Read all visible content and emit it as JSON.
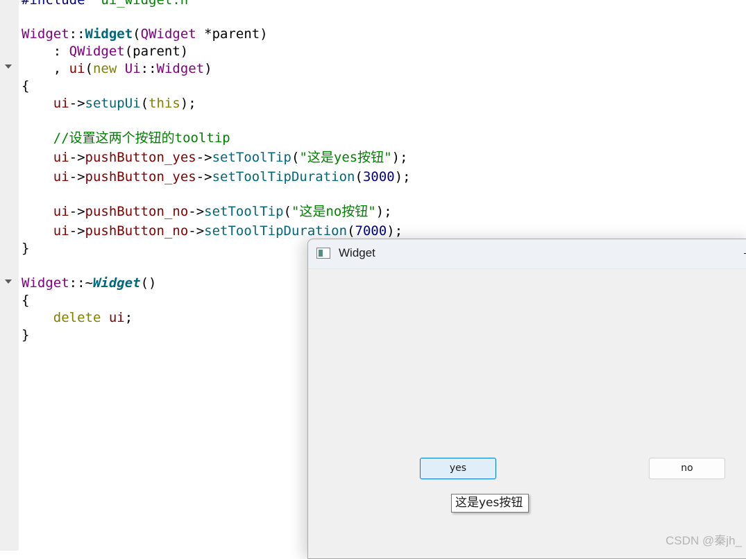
{
  "editor": {
    "lines": {
      "include": {
        "a": "#include \"",
        "b": "ui_widget.h",
        "c": "\""
      },
      "ctor": {
        "cls": "Widget",
        "sep": "::",
        "fn": "Widget",
        "open": "(",
        "type": "QWidget",
        "rest": " *parent)"
      },
      "init1": {
        "pre": "    : ",
        "base": "QWidget",
        "arg": "(parent)"
      },
      "init2": {
        "pre": "    , ",
        "member": "ui",
        "open": "(",
        "kw": "new",
        "sp": " ",
        "ns": "Ui",
        "sep": "::",
        "cls": "Widget",
        "close": ")"
      },
      "brace_open_1": "{",
      "setup": {
        "pre": "    ",
        "member": "ui",
        "arrow": "->",
        "fn": "setupUi",
        "open": "(",
        "kw": "this",
        "close": ");"
      },
      "comment": "    //设置这两个按钮的tooltip",
      "yes_tip": {
        "pre": "    ",
        "member": "ui",
        "arrow": "->",
        "obj": "pushButton_yes",
        "arrow2": "->",
        "fn": "setToolTip",
        "open": "(",
        "str": "\"这是yes按钮\"",
        "close": ");"
      },
      "yes_dur": {
        "pre": "    ",
        "member": "ui",
        "arrow": "->",
        "obj": "pushButton_yes",
        "arrow2": "->",
        "fn": "setToolTipDuration",
        "open": "(",
        "num": "3000",
        "close": ");"
      },
      "no_tip": {
        "pre": "    ",
        "member": "ui",
        "arrow": "->",
        "obj": "pushButton_no",
        "arrow2": "->",
        "fn": "setToolTip",
        "open": "(",
        "str": "\"这是no按钮\"",
        "close": ");"
      },
      "no_dur": {
        "pre": "    ",
        "member": "ui",
        "arrow": "->",
        "obj": "pushButton_no",
        "arrow2": "->",
        "fn": "setToolTipDuration",
        "open": "(",
        "num": "7000",
        "close": ");"
      },
      "brace_close_1": "}",
      "dtor": {
        "cls": "Widget",
        "sep": "::~",
        "fn": "Widget",
        "rest": "()"
      },
      "brace_open_2": "{",
      "delete": {
        "pre": "    ",
        "kw": "delete",
        "sp": " ",
        "member": "ui",
        "semi": ";"
      },
      "brace_close_2": "}"
    }
  },
  "window": {
    "title": "Widget",
    "icon": "qt-window-icon",
    "yes_button": "yes",
    "no_button": "no",
    "tooltip": "这是yes按钮"
  },
  "watermark": "CSDN @秦jh_"
}
